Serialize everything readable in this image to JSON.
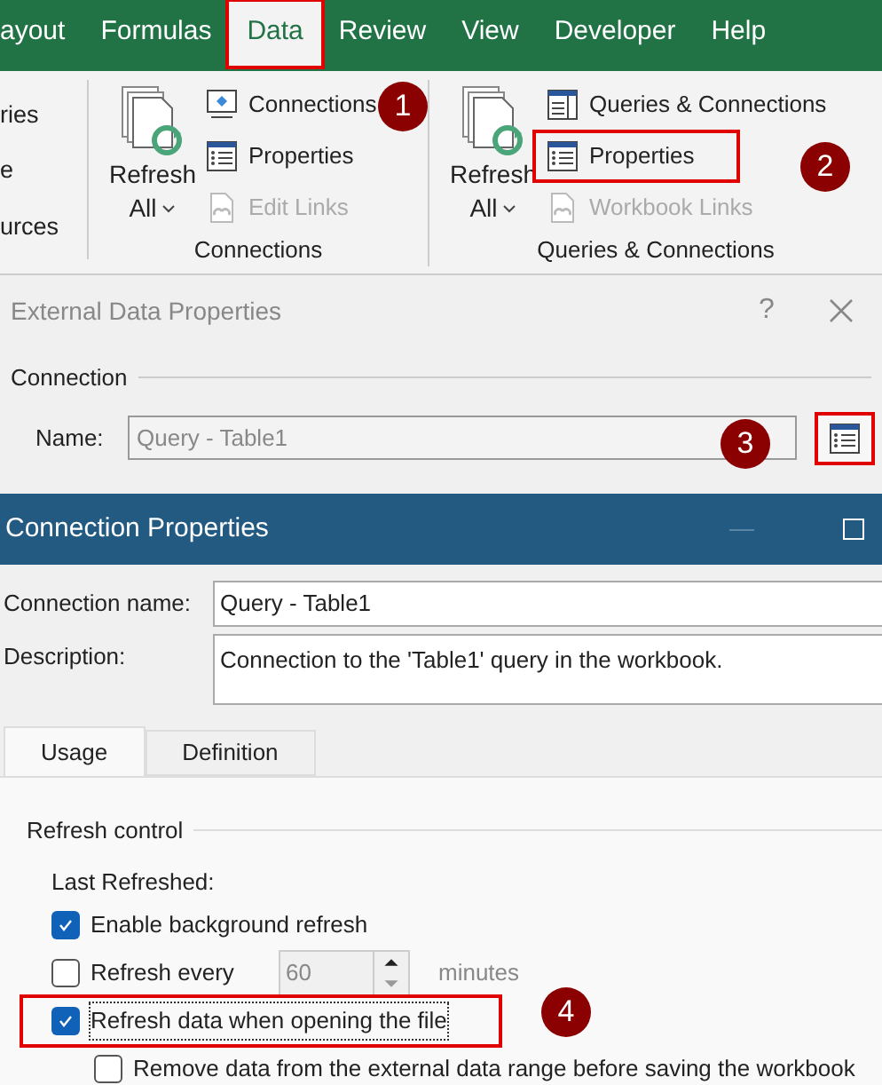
{
  "ribbon": {
    "tabs": [
      {
        "label": "ayout",
        "selected": false,
        "highlighted": false
      },
      {
        "label": "Formulas",
        "selected": false,
        "highlighted": false
      },
      {
        "label": "Data",
        "selected": true,
        "highlighted": true
      },
      {
        "label": "Review",
        "selected": false,
        "highlighted": false
      },
      {
        "label": "View",
        "selected": false,
        "highlighted": false
      },
      {
        "label": "Developer",
        "selected": false,
        "highlighted": false
      },
      {
        "label": "Help",
        "selected": false,
        "highlighted": false
      }
    ],
    "cut_group": {
      "items": [
        "ries",
        "e",
        "urces"
      ]
    },
    "groups": [
      {
        "label": "Connections",
        "big_button": {
          "line1": "Refresh",
          "line2": "All"
        },
        "items": [
          {
            "kind": "connections",
            "label": "Connections",
            "disabled": false,
            "highlighted": false
          },
          {
            "kind": "properties",
            "label": "Properties",
            "disabled": false,
            "highlighted": false
          },
          {
            "kind": "links",
            "label": "Edit Links",
            "disabled": true,
            "highlighted": false
          }
        ]
      },
      {
        "label": "Queries & Connections",
        "big_button": {
          "line1": "Refresh",
          "line2": "All"
        },
        "items": [
          {
            "kind": "queries",
            "label": "Queries & Connections",
            "disabled": false,
            "highlighted": false
          },
          {
            "kind": "properties",
            "label": "Properties",
            "disabled": false,
            "highlighted": true
          },
          {
            "kind": "links",
            "label": "Workbook Links",
            "disabled": true,
            "highlighted": false
          }
        ]
      }
    ]
  },
  "external_dialog": {
    "title": "External Data Properties",
    "help": "?",
    "section": "Connection",
    "name_label": "Name:",
    "name_value": "Query - Table1",
    "properties_button_highlighted": true
  },
  "connection_dialog": {
    "title": "Connection Properties",
    "name_label": "Connection name:",
    "name_value": "Query - Table1",
    "description_label": "Description:",
    "description_value": "Connection to the 'Table1' query in the workbook.",
    "tabs": [
      {
        "label": "Usage",
        "selected": true
      },
      {
        "label": "Definition",
        "selected": false
      }
    ],
    "refresh_control": {
      "heading": "Refresh control",
      "last_refreshed": "Last Refreshed:",
      "options": [
        {
          "kind": "checkbox",
          "label": "Enable background refresh",
          "checked": true,
          "highlighted": false,
          "indented": false
        },
        {
          "kind": "interval",
          "label": "Refresh every",
          "checked": false,
          "highlighted": false,
          "indented": false,
          "value": "60",
          "unit": "minutes"
        },
        {
          "kind": "checkbox",
          "label": "Refresh data when opening the file",
          "checked": true,
          "highlighted": true,
          "indented": false
        },
        {
          "kind": "checkbox",
          "label": "Remove data from the external data range before saving the workbook",
          "checked": false,
          "highlighted": false,
          "indented": true
        }
      ]
    }
  },
  "callouts": [
    {
      "label": "1"
    },
    {
      "label": "2"
    },
    {
      "label": "3"
    },
    {
      "label": "4"
    }
  ]
}
